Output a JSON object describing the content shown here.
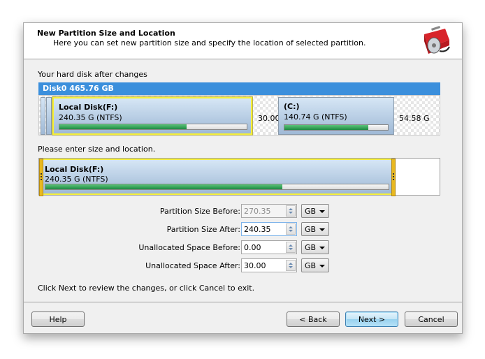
{
  "header": {
    "title": "New Partition Size and Location",
    "subtitle": "Here you can set new partition size and specify the location of selected partition."
  },
  "disk_label": "Your hard disk after changes",
  "disk": {
    "name": "Disk0  465.76 GB",
    "partitions": [
      {
        "name": "Local Disk(F:)",
        "size": "240.35 G  (NTFS)",
        "used_fraction": 0.68,
        "selected": true
      },
      {
        "name": "(C:)",
        "size": "140.74 G  (NTFS)",
        "used_fraction": 0.81,
        "selected": false
      }
    ],
    "unallocated": [
      {
        "label": "30.00"
      },
      {
        "label": "54.58 G"
      }
    ]
  },
  "edit_label": "Please enter size and location.",
  "edit_partition": {
    "name": "Local Disk(F:)",
    "size": "240.35 G  (NTFS)",
    "used_fraction": 0.69
  },
  "form": {
    "rows": [
      {
        "label": "Partition Size Before:",
        "value": "270.35",
        "unit": "GB",
        "disabled": true
      },
      {
        "label": "Partition Size After:",
        "value": "240.35",
        "unit": "GB",
        "disabled": false
      },
      {
        "label": "Unallocated Space Before:",
        "value": "0.00",
        "unit": "GB",
        "disabled": false
      },
      {
        "label": "Unallocated Space After:",
        "value": "30.00",
        "unit": "GB",
        "disabled": false
      }
    ]
  },
  "hint": "Click Next to review the changes, or click Cancel to exit.",
  "buttons": {
    "help": "Help",
    "back": "< Back",
    "next": "Next >",
    "cancel": "Cancel"
  }
}
